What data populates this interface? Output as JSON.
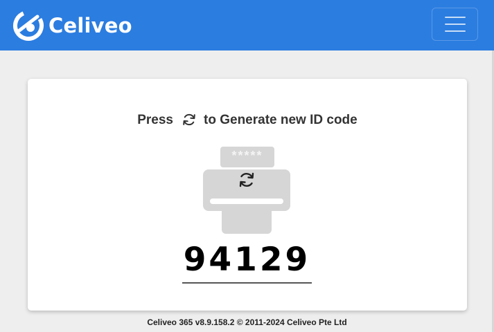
{
  "header": {
    "brand_name": "Celiveo",
    "logo_icon": "celiveo-logo-icon",
    "menu_icon": "hamburger-menu-icon",
    "background_color": "#2b7de0"
  },
  "main": {
    "instruction_before": "Press",
    "instruction_icon": "refresh-icon",
    "instruction_after": "to Generate new ID code",
    "printer_icon": "printer-refresh-icon",
    "printer_paper_text": "*****",
    "id_code": "94129"
  },
  "footer": {
    "text": "Celiveo 365 v8.9.158.2 © 2011-2024 Celiveo Pte Ltd"
  }
}
